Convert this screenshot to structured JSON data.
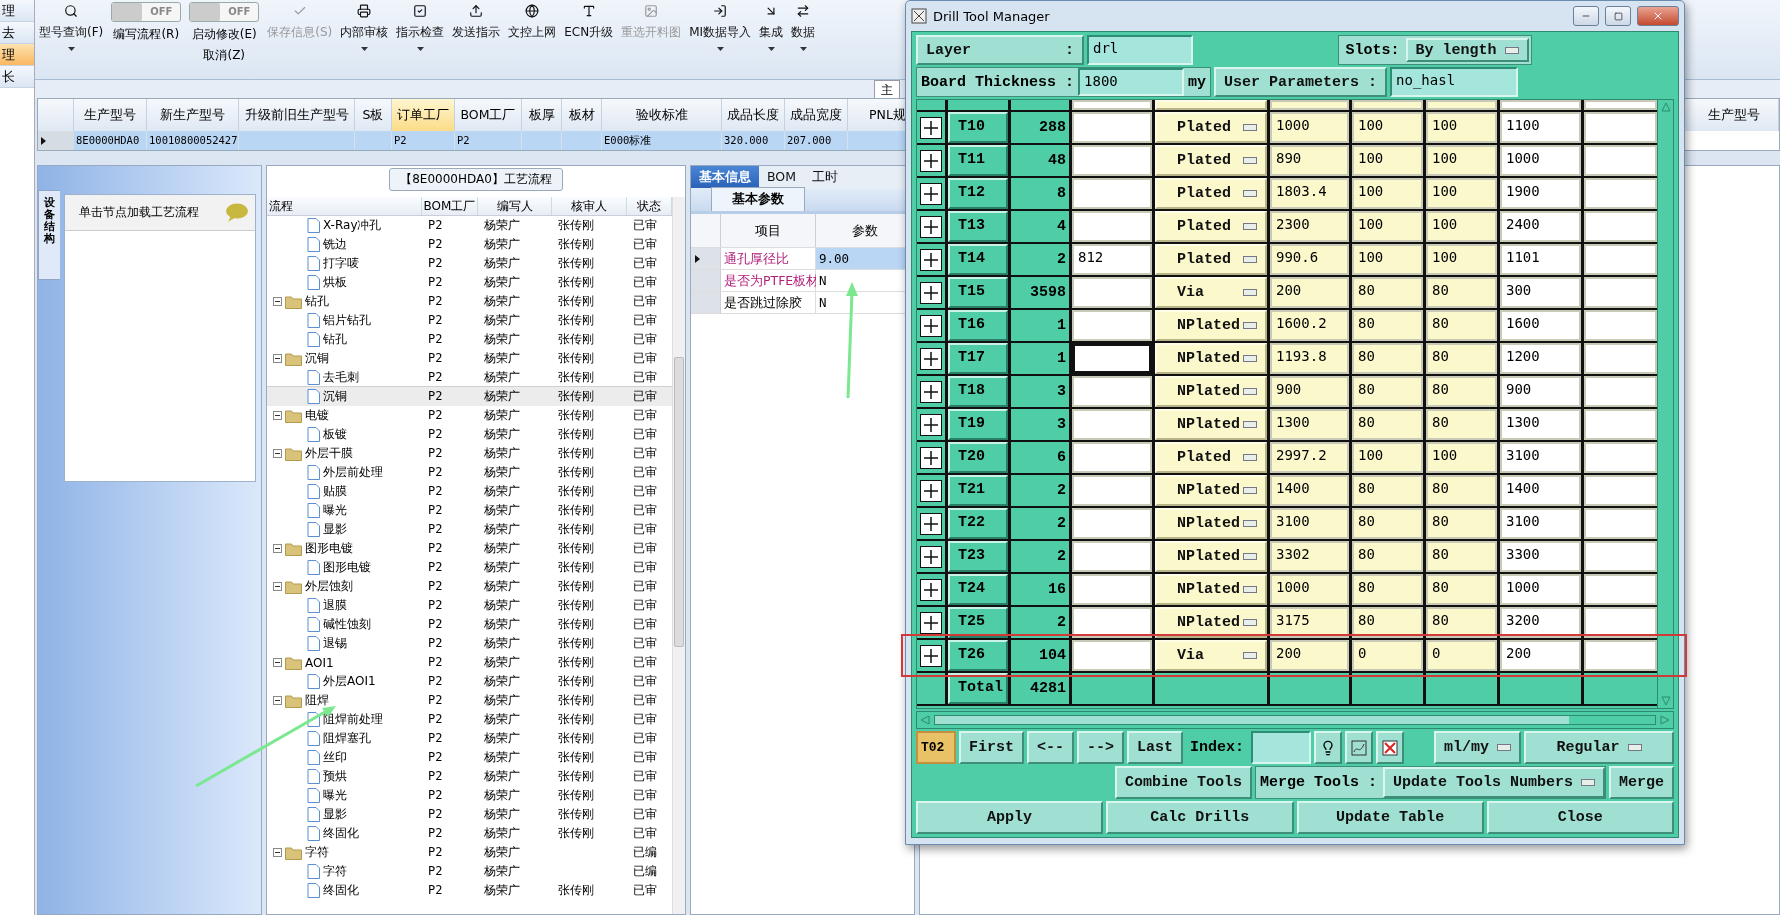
{
  "nav": [
    {
      "label": "理",
      "selected": false
    },
    {
      "label": "去",
      "selected": false
    },
    {
      "label": "理",
      "selected": true
    },
    {
      "label": "长",
      "selected": false
    }
  ],
  "toolbar": [
    {
      "kind": "button",
      "label": "型号查询(F)",
      "has_menu": true,
      "disabled": false
    },
    {
      "kind": "toggle",
      "label": "编写流程(R)",
      "switch_text": "OFF",
      "on": false
    },
    {
      "kind": "toggle",
      "label": "启动修改(E)",
      "second_line": "取消(Z)",
      "switch_text": "OFF",
      "on": false
    },
    {
      "kind": "button",
      "label": "保存信息(S)",
      "has_menu": false,
      "disabled": true
    },
    {
      "kind": "button",
      "label": "内部审核",
      "has_menu": true,
      "disabled": false
    },
    {
      "kind": "button",
      "label": "指示检查",
      "has_menu": true,
      "disabled": false
    },
    {
      "kind": "button",
      "label": "发送指示",
      "has_menu": false,
      "disabled": false
    },
    {
      "kind": "button",
      "label": "文控上网",
      "has_menu": false,
      "disabled": false
    },
    {
      "kind": "button",
      "label": "ECN升级",
      "has_menu": false,
      "disabled": false
    },
    {
      "kind": "button",
      "label": "重选开料图",
      "has_menu": false,
      "disabled": true
    },
    {
      "kind": "button",
      "label": "MI数据导入",
      "has_menu": true,
      "disabled": false
    },
    {
      "kind": "button",
      "label": "集成",
      "has_menu": true,
      "disabled": false
    },
    {
      "kind": "button",
      "label": "数据",
      "has_menu": true,
      "disabled": false
    }
  ],
  "main_tab": "主",
  "order_grid": {
    "columns": [
      {
        "label": "生产型号",
        "sorted": false
      },
      {
        "label": "新生产型号",
        "sorted": false
      },
      {
        "label": "升级前旧生产型号",
        "sorted": false
      },
      {
        "label": "S板",
        "sorted": false
      },
      {
        "label": "订单工厂",
        "sorted": true
      },
      {
        "label": "BOM工厂",
        "sorted": false
      },
      {
        "label": "板厚",
        "sorted": false
      },
      {
        "label": "板材",
        "sorted": false
      },
      {
        "label": "验收标准",
        "sorted": false
      },
      {
        "label": "成品长度",
        "sorted": false
      },
      {
        "label": "成品宽度",
        "sorted": false
      },
      {
        "label": "PNL规",
        "sorted": false
      }
    ],
    "last_column": "生产型号",
    "rows": [
      {
        "cells": [
          "8E0000HDA0",
          "10010800052427",
          "",
          "",
          "P2",
          "P2",
          "",
          "",
          "E000标准",
          "320.000",
          "207.000",
          ""
        ],
        "selected": true
      }
    ]
  },
  "side_panel": {
    "tab": "设备结构",
    "hint": "单击节点加载工艺流程"
  },
  "flow": {
    "title": "【8E0000HDA0】工艺流程",
    "columns": [
      "流程",
      "BOM工厂",
      "编写人",
      "核审人",
      "状态"
    ],
    "nodes": [
      {
        "children": [
          {
            "label": "X-Ray冲孔",
            "bom": "P2",
            "writer": "杨荣广",
            "reviewer": "张传刚",
            "status": "已审",
            "selected": false
          },
          {
            "label": "铣边",
            "bom": "P2",
            "writer": "杨荣广",
            "reviewer": "张传刚",
            "status": "已审",
            "selected": false
          },
          {
            "label": "打字唛",
            "bom": "P2",
            "writer": "杨荣广",
            "reviewer": "张传刚",
            "status": "已审",
            "selected": false
          },
          {
            "label": "烘板",
            "bom": "P2",
            "writer": "杨荣广",
            "reviewer": "张传刚",
            "status": "已审",
            "selected": false
          }
        ]
      },
      {
        "label": "钻孔",
        "bom": "P2",
        "writer": "杨荣广",
        "reviewer": "张传刚",
        "status": "已审",
        "selected": false,
        "expanded": true,
        "children": [
          {
            "label": "铝片钻孔",
            "bom": "P2",
            "writer": "杨荣广",
            "reviewer": "张传刚",
            "status": "已审",
            "selected": false
          },
          {
            "label": "钻孔",
            "bom": "P2",
            "writer": "杨荣广",
            "reviewer": "张传刚",
            "status": "已审",
            "selected": false
          }
        ]
      },
      {
        "label": "沉铜",
        "bom": "P2",
        "writer": "杨荣广",
        "reviewer": "张传刚",
        "status": "已审",
        "selected": false,
        "expanded": true,
        "children": [
          {
            "label": "去毛刺",
            "bom": "P2",
            "writer": "杨荣广",
            "reviewer": "张传刚",
            "status": "已审",
            "selected": false
          },
          {
            "label": "沉铜",
            "bom": "P2",
            "writer": "杨荣广",
            "reviewer": "张传刚",
            "status": "已审",
            "selected": true
          }
        ]
      },
      {
        "label": "电镀",
        "bom": "P2",
        "writer": "杨荣广",
        "reviewer": "张传刚",
        "status": "已审",
        "selected": false,
        "expanded": true,
        "children": [
          {
            "label": "板镀",
            "bom": "P2",
            "writer": "杨荣广",
            "reviewer": "张传刚",
            "status": "已审",
            "selected": false
          }
        ]
      },
      {
        "label": "外层干膜",
        "bom": "P2",
        "writer": "杨荣广",
        "reviewer": "张传刚",
        "status": "已审",
        "selected": false,
        "expanded": true,
        "children": [
          {
            "label": "外层前处理",
            "bom": "P2",
            "writer": "杨荣广",
            "reviewer": "张传刚",
            "status": "已审",
            "selected": false
          },
          {
            "label": "贴膜",
            "bom": "P2",
            "writer": "杨荣广",
            "reviewer": "张传刚",
            "status": "已审",
            "selected": false
          },
          {
            "label": "曝光",
            "bom": "P2",
            "writer": "杨荣广",
            "reviewer": "张传刚",
            "status": "已审",
            "selected": false
          },
          {
            "label": "显影",
            "bom": "P2",
            "writer": "杨荣广",
            "reviewer": "张传刚",
            "status": "已审",
            "selected": false
          }
        ]
      },
      {
        "label": "图形电镀",
        "bom": "P2",
        "writer": "杨荣广",
        "reviewer": "张传刚",
        "status": "已审",
        "selected": false,
        "expanded": true,
        "children": [
          {
            "label": "图形电镀",
            "bom": "P2",
            "writer": "杨荣广",
            "reviewer": "张传刚",
            "status": "已审",
            "selected": false
          }
        ]
      },
      {
        "label": "外层蚀刻",
        "bom": "P2",
        "writer": "杨荣广",
        "reviewer": "张传刚",
        "status": "已审",
        "selected": false,
        "expanded": true,
        "children": [
          {
            "label": "退膜",
            "bom": "P2",
            "writer": "杨荣广",
            "reviewer": "张传刚",
            "status": "已审",
            "selected": false
          },
          {
            "label": "碱性蚀刻",
            "bom": "P2",
            "writer": "杨荣广",
            "reviewer": "张传刚",
            "status": "已审",
            "selected": false
          },
          {
            "label": "退锡",
            "bom": "P2",
            "writer": "杨荣广",
            "reviewer": "张传刚",
            "status": "已审",
            "selected": false
          }
        ]
      },
      {
        "label": "AOI1",
        "bom": "P2",
        "writer": "杨荣广",
        "reviewer": "张传刚",
        "status": "已审",
        "selected": false,
        "expanded": true,
        "children": [
          {
            "label": "外层AOI1",
            "bom": "P2",
            "writer": "杨荣广",
            "reviewer": "张传刚",
            "status": "已审",
            "selected": false
          }
        ]
      },
      {
        "label": "阻焊",
        "bom": "P2",
        "writer": "杨荣广",
        "reviewer": "张传刚",
        "status": "已审",
        "selected": false,
        "expanded": true,
        "children": [
          {
            "label": "阻焊前处理",
            "bom": "P2",
            "writer": "杨荣广",
            "reviewer": "张传刚",
            "status": "已审",
            "selected": false
          },
          {
            "label": "阻焊塞孔",
            "bom": "P2",
            "writer": "杨荣广",
            "reviewer": "张传刚",
            "status": "已审",
            "selected": false
          },
          {
            "label": "丝印",
            "bom": "P2",
            "writer": "杨荣广",
            "reviewer": "张传刚",
            "status": "已审",
            "selected": false
          },
          {
            "label": "预烘",
            "bom": "P2",
            "writer": "杨荣广",
            "reviewer": "张传刚",
            "status": "已审",
            "selected": false
          },
          {
            "label": "曝光",
            "bom": "P2",
            "writer": "杨荣广",
            "reviewer": "张传刚",
            "status": "已审",
            "selected": false
          },
          {
            "label": "显影",
            "bom": "P2",
            "writer": "杨荣广",
            "reviewer": "张传刚",
            "status": "已审",
            "selected": false
          },
          {
            "label": "终固化",
            "bom": "P2",
            "writer": "杨荣广",
            "reviewer": "张传刚",
            "status": "已审",
            "selected": false
          }
        ]
      },
      {
        "label": "字符",
        "bom": "P2",
        "writer": "杨荣广",
        "status": "已编",
        "selected": false,
        "expanded": true,
        "children": [
          {
            "label": "字符",
            "bom": "P2",
            "writer": "杨荣广",
            "status": "已编",
            "selected": false
          },
          {
            "label": "终固化",
            "bom": "P2",
            "writer": "杨荣广",
            "reviewer": "张传刚",
            "status": "已审",
            "selected": false
          }
        ]
      }
    ]
  },
  "info": {
    "tabs": [
      {
        "label": "基本信息",
        "selected": true
      },
      {
        "label": "BOM",
        "selected": false
      },
      {
        "label": "工时",
        "selected": false
      }
    ],
    "sub_tab": "基本参数",
    "columns": [
      "项目",
      "参数"
    ],
    "rows": [
      {
        "item": "通孔厚径比",
        "value": "9.00",
        "emphasized": true,
        "selected": true
      },
      {
        "item": "是否为PTFE板材",
        "value": "N",
        "emphasized": true,
        "selected": false
      },
      {
        "item": "是否跳过除胶",
        "value": "N",
        "emphasized": false,
        "selected": false
      }
    ]
  },
  "dialog": {
    "title": "Drill Tool Manager",
    "layer_label": "Layer",
    "layer_colon": ":",
    "layer": "drl",
    "slots_label": "Slots:",
    "slots": "By length",
    "thickness_label": "Board Thickness :",
    "thickness": "1800",
    "thickness_unit": "my",
    "user_params_label": "User Parameters :",
    "user_params": "no_hasl",
    "tools": [
      {
        "tool": "T10",
        "count": "288",
        "type": "Plated",
        "field_2": "1000",
        "field_3": "100",
        "field_4": "100",
        "field_5": "1100",
        "focused": false,
        "marked": false
      },
      {
        "tool": "T11",
        "count": "48",
        "type": "Plated",
        "field_2": "890",
        "field_3": "100",
        "field_4": "100",
        "field_5": "1000",
        "focused": false,
        "marked": false
      },
      {
        "tool": "T12",
        "count": "8",
        "type": "Plated",
        "field_2": "1803.4",
        "field_3": "100",
        "field_4": "100",
        "field_5": "1900",
        "focused": false,
        "marked": false
      },
      {
        "tool": "T13",
        "count": "4",
        "type": "Plated",
        "field_2": "2300",
        "field_3": "100",
        "field_4": "100",
        "field_5": "2400",
        "focused": false,
        "marked": false
      },
      {
        "tool": "T14",
        "count": "2",
        "field_1": "812",
        "type": "Plated",
        "field_2": "990.6",
        "field_3": "100",
        "field_4": "100",
        "field_5": "1101",
        "focused": false,
        "marked": false
      },
      {
        "tool": "T15",
        "count": "3598",
        "type": "Via",
        "field_2": "200",
        "field_3": "80",
        "field_4": "80",
        "field_5": "300",
        "focused": false,
        "marked": false
      },
      {
        "tool": "T16",
        "count": "1",
        "type": "NPlated",
        "field_2": "1600.2",
        "field_3": "80",
        "field_4": "80",
        "field_5": "1600",
        "focused": false,
        "marked": false
      },
      {
        "tool": "T17",
        "count": "1",
        "type": "NPlated",
        "field_2": "1193.8",
        "field_3": "80",
        "field_4": "80",
        "field_5": "1200",
        "focused": true,
        "marked": false
      },
      {
        "tool": "T18",
        "count": "3",
        "type": "NPlated",
        "field_2": "900",
        "field_3": "80",
        "field_4": "80",
        "field_5": "900",
        "focused": false,
        "marked": false
      },
      {
        "tool": "T19",
        "count": "3",
        "type": "NPlated",
        "field_2": "1300",
        "field_3": "80",
        "field_4": "80",
        "field_5": "1300",
        "focused": false,
        "marked": false
      },
      {
        "tool": "T20",
        "count": "6",
        "type": "Plated",
        "field_2": "2997.2",
        "field_3": "100",
        "field_4": "100",
        "field_5": "3100",
        "focused": false,
        "marked": false
      },
      {
        "tool": "T21",
        "count": "2",
        "type": "NPlated",
        "field_2": "1400",
        "field_3": "80",
        "field_4": "80",
        "field_5": "1400",
        "focused": false,
        "marked": false
      },
      {
        "tool": "T22",
        "count": "2",
        "type": "NPlated",
        "field_2": "3100",
        "field_3": "80",
        "field_4": "80",
        "field_5": "3100",
        "focused": false,
        "marked": false
      },
      {
        "tool": "T23",
        "count": "2",
        "type": "NPlated",
        "field_2": "3302",
        "field_3": "80",
        "field_4": "80",
        "field_5": "3300",
        "focused": false,
        "marked": false
      },
      {
        "tool": "T24",
        "count": "16",
        "type": "NPlated",
        "field_2": "1000",
        "field_3": "80",
        "field_4": "80",
        "field_5": "1000",
        "focused": false,
        "marked": false
      },
      {
        "tool": "T25",
        "count": "2",
        "type": "NPlated",
        "field_2": "3175",
        "field_3": "80",
        "field_4": "80",
        "field_5": "3200",
        "focused": false,
        "marked": false
      },
      {
        "tool": "T26",
        "count": "104",
        "type": "Via",
        "field_2": "200",
        "field_3": "0",
        "field_4": "0",
        "field_5": "200",
        "focused": false,
        "marked": true
      }
    ],
    "total_label": "Total",
    "total": "4281",
    "current_tool": "T02",
    "nav_buttons": [
      "First",
      "<--",
      "-->",
      "Last"
    ],
    "index_label": "Index:",
    "units": "ml/my",
    "mode": "Regular",
    "combine": "Combine Tools",
    "merge_label": "Merge Tools :",
    "merge_mode": "Update Tools Numbers",
    "merge": "Merge",
    "actions": [
      "Apply",
      "Calc Drills",
      "Update Table",
      "Close"
    ]
  }
}
